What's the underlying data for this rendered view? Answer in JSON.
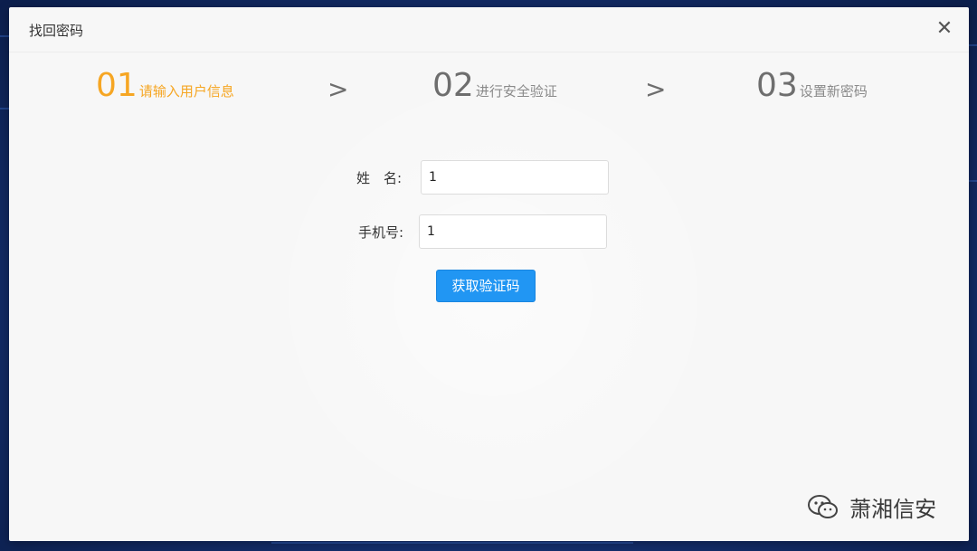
{
  "dialog": {
    "title": "找回密码",
    "close_label": "✕"
  },
  "steps": [
    {
      "num": "01",
      "label": "请输入用户信息",
      "state": "active"
    },
    {
      "num": "02",
      "label": "进行安全验证",
      "state": "inactive"
    },
    {
      "num": "03",
      "label": "设置新密码",
      "state": "inactive"
    }
  ],
  "step_separator": ">",
  "form": {
    "name_label": "姓　名:",
    "name_value": "1",
    "phone_label": "手机号:",
    "phone_value": "1",
    "submit_label": "获取验证码"
  },
  "watermark": {
    "text": "萧湘信安",
    "icon": "wechat-icon"
  },
  "colors": {
    "active_step": "#f6a623",
    "inactive_step": "#6e6e6e",
    "primary_button": "#2196f3",
    "background": "#15306f"
  }
}
